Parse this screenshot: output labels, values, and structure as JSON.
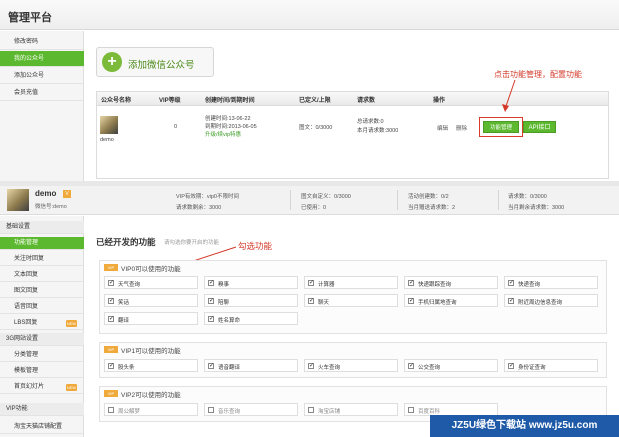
{
  "app": {
    "title": "管理平台"
  },
  "sidebar1": {
    "items": [
      {
        "label": "修改密码",
        "active": false
      },
      {
        "label": "我的公众号",
        "active": true
      },
      {
        "label": "添加公众号",
        "active": false
      },
      {
        "label": "会员充值",
        "active": false
      }
    ]
  },
  "main1": {
    "add_button": "添加微信公众号",
    "annotation": "点击功能管理，配置功能",
    "table": {
      "headers": [
        "公众号名称",
        "VIP等级",
        "创建时间/到期时间",
        "已定义/上限",
        "请求数",
        "操作"
      ],
      "row": {
        "name": "demo",
        "vip": "0",
        "created": "创建时间:13-06-22",
        "expires": "到期时间:2013-06-05",
        "renew": "升级/续vip特惠",
        "defined": "图文：0/3000",
        "requests_total": "总请求数:0",
        "requests_month": "本月请求数:3000",
        "edit": "编辑",
        "delete": "删除",
        "func_button": "功能管理",
        "api_button": "API接口"
      }
    }
  },
  "account_bar": {
    "name": "demo",
    "vip_badge": "V",
    "sub": "微信号:demo",
    "stats": [
      [
        "VIP有效期：vip0不限时间",
        "请求数剩余：3000"
      ],
      [
        "图文自定义：0/3000",
        "已使用：0"
      ],
      [
        "活动创建数：0/2",
        "当月赠送请求数：2"
      ],
      [
        "请求数：0/3000",
        "当月剩余请求数：3000"
      ]
    ]
  },
  "sidebar2": {
    "items": [
      {
        "label": "基础设置",
        "type": "group"
      },
      {
        "label": "功能管理",
        "type": "active"
      },
      {
        "label": "关注时回复",
        "type": "item"
      },
      {
        "label": "文本回复",
        "type": "item"
      },
      {
        "label": "图文回复",
        "type": "item"
      },
      {
        "label": "语音回复",
        "type": "item"
      },
      {
        "label": "LBS回复",
        "type": "item",
        "tag": "NEW"
      },
      {
        "label": "3G网站设置",
        "type": "group"
      },
      {
        "label": "分类管理",
        "type": "item"
      },
      {
        "label": "模板管理",
        "type": "item"
      },
      {
        "label": "首页幻灯片",
        "type": "item",
        "tag": "NEW"
      },
      {
        "label": "VIP功能",
        "type": "group"
      },
      {
        "label": "淘宝天猫店铺配置",
        "type": "item"
      }
    ]
  },
  "features": {
    "section_title": "已经开发的功能",
    "section_hint": "请勾选你要开启的功能",
    "annotation": "勾选功能",
    "panels": [
      {
        "badge": "VIP",
        "title": "VIP0可以使用的功能",
        "items": [
          {
            "label": "天气查询",
            "checked": true
          },
          {
            "label": "糗事",
            "checked": true
          },
          {
            "label": "计算器",
            "checked": true
          },
          {
            "label": "快递跟踪查询",
            "checked": true
          },
          {
            "label": "快递查询",
            "checked": true
          },
          {
            "label": "笑话",
            "checked": true
          },
          {
            "label": "陪聊",
            "checked": true
          },
          {
            "label": "聊天",
            "checked": true
          },
          {
            "label": "手机归属地查询",
            "checked": true
          },
          {
            "label": "附近周边信息查询",
            "checked": true
          },
          {
            "label": "翻译",
            "checked": true
          },
          {
            "label": "姓名算命",
            "checked": true
          }
        ]
      },
      {
        "badge": "VIP",
        "title": "VIP1可以使用的功能",
        "items": [
          {
            "label": "股头条",
            "checked": true
          },
          {
            "label": "语音翻译",
            "checked": true
          },
          {
            "label": "火车查询",
            "checked": true
          },
          {
            "label": "公交查询",
            "checked": true
          },
          {
            "label": "身份证查询",
            "checked": true
          }
        ]
      },
      {
        "badge": "VIP",
        "title": "VIP2可以使用的功能",
        "items": [
          {
            "label": "周公解梦",
            "checked": false
          },
          {
            "label": "音乐查询",
            "checked": false
          },
          {
            "label": "淘宝店铺",
            "checked": false
          },
          {
            "label": "百度百科",
            "checked": false
          }
        ]
      }
    ]
  },
  "watermark": "JZ5U绿色下载站 www.jz5u.com",
  "colors": {
    "accent": "#5cb82e",
    "annotation": "#d33a2a",
    "badge": "#f0a93b"
  }
}
